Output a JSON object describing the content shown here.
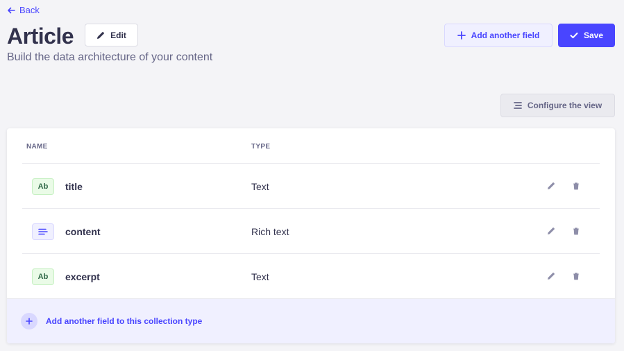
{
  "nav": {
    "back_label": "Back"
  },
  "header": {
    "title": "Article",
    "edit_label": "Edit",
    "subtitle": "Build the data architecture of your content",
    "add_field_label": "Add another field",
    "save_label": "Save"
  },
  "toolbar": {
    "configure_label": "Configure the view"
  },
  "table": {
    "columns": [
      "NAME",
      "TYPE"
    ],
    "rows": [
      {
        "badge": "Ab",
        "icon": "text-icon",
        "name": "title",
        "type": "Text"
      },
      {
        "badge": "",
        "icon": "richtext-icon",
        "name": "content",
        "type": "Rich text"
      },
      {
        "badge": "Ab",
        "icon": "text-icon",
        "name": "excerpt",
        "type": "Text"
      }
    ]
  },
  "footer": {
    "add_label": "Add another field to this collection type"
  },
  "colors": {
    "primary": "#4945ff",
    "primary_light": "#f0f0ff",
    "text_dark": "#32324d",
    "text_muted": "#666687",
    "background": "#f4f4f7",
    "text_badge_bg": "#eafbe7"
  }
}
